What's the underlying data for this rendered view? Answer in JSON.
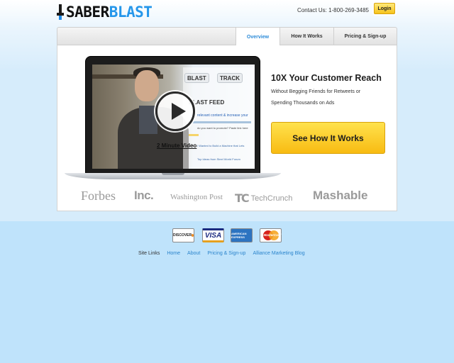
{
  "header": {
    "logo_saber": "SABER",
    "logo_blast": "BLAST",
    "contact": "Contact Us: 1-800-269-3485",
    "login_label": "Login"
  },
  "tabs": [
    {
      "label": "Overview",
      "active": true
    },
    {
      "label": "How It Works",
      "active": false
    },
    {
      "label": "Pricing & Sign-up",
      "active": false
    }
  ],
  "video": {
    "caption": "2 Minute Video",
    "screen_tabs": [
      "BLAST",
      "TRACK"
    ],
    "screen_feed": "BLAST FEED",
    "screen_line1": "relevant content & increase your",
    "screen_line2": "do you want to promote? Paste link here",
    "screen_link1": "I Wanted to Build a Machine that Lets",
    "screen_link2": "Top Ideas from Steel World Forum"
  },
  "hero": {
    "headline": "10X Your Customer Reach",
    "subtext": "Without Begging Friends for Retweets or Spending Thousands on Ads",
    "cta_label": "See How It Works"
  },
  "press": [
    "Forbes",
    "Inc.",
    "Washington Post",
    "TechCrunch",
    "Mashable"
  ],
  "press_tc_mark": "TC",
  "payments": {
    "discover": "DISCOVER",
    "visa": "VISA",
    "amex": "AMERICAN EXPRESS",
    "mastercard": "MasterCard"
  },
  "footer": {
    "label": "Site Links",
    "links": [
      "Home",
      "About",
      "Pricing & Sign-up",
      "Alliance Marketing Blog"
    ]
  },
  "colors": {
    "brand_blue": "#2596ea",
    "cta_yellow": "#f8bb12",
    "page_bg": "#bfe3fb"
  }
}
